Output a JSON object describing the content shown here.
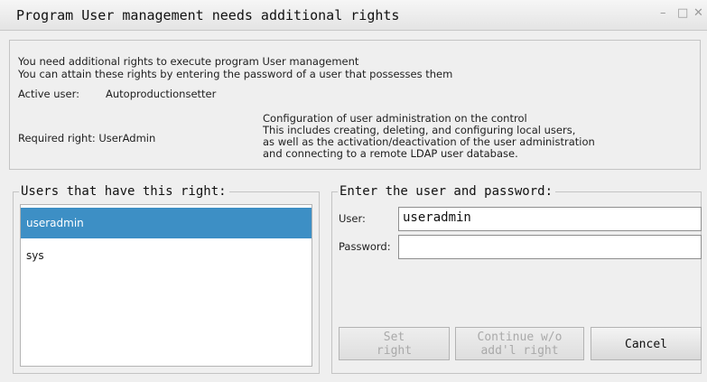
{
  "window": {
    "title": "Program User management needs additional rights",
    "minimize_glyph": "–",
    "maximize_glyph": "□",
    "close_glyph": "✕"
  },
  "info": {
    "line1": "You need additional rights to execute program User management",
    "line2": "You can attain these rights by entering the password of a user that possesses them",
    "active_user_label": "Active user:",
    "active_user_value": "Autoproductionsetter",
    "required_right": "Required right: UserAdmin",
    "description": [
      "Configuration of user administration on the control",
      "This includes creating, deleting, and configuring local users,",
      "as well as the activation/deactivation of the user administration",
      "and connecting to a remote LDAP user database."
    ]
  },
  "users_panel": {
    "legend": "Users that have this right:",
    "users": [
      "useradmin",
      "sys"
    ],
    "selected_index": 0
  },
  "login_panel": {
    "legend": "Enter the user and password:",
    "user_label": "User:",
    "user_value": "useradmin",
    "password_label": "Password:",
    "password_value": ""
  },
  "buttons": {
    "set_right": [
      "Set",
      "right"
    ],
    "continue": [
      "Continue w/o",
      "add'l right"
    ],
    "cancel": "Cancel"
  },
  "colors": {
    "selection": "#3d8fc5",
    "background": "#efefef"
  }
}
